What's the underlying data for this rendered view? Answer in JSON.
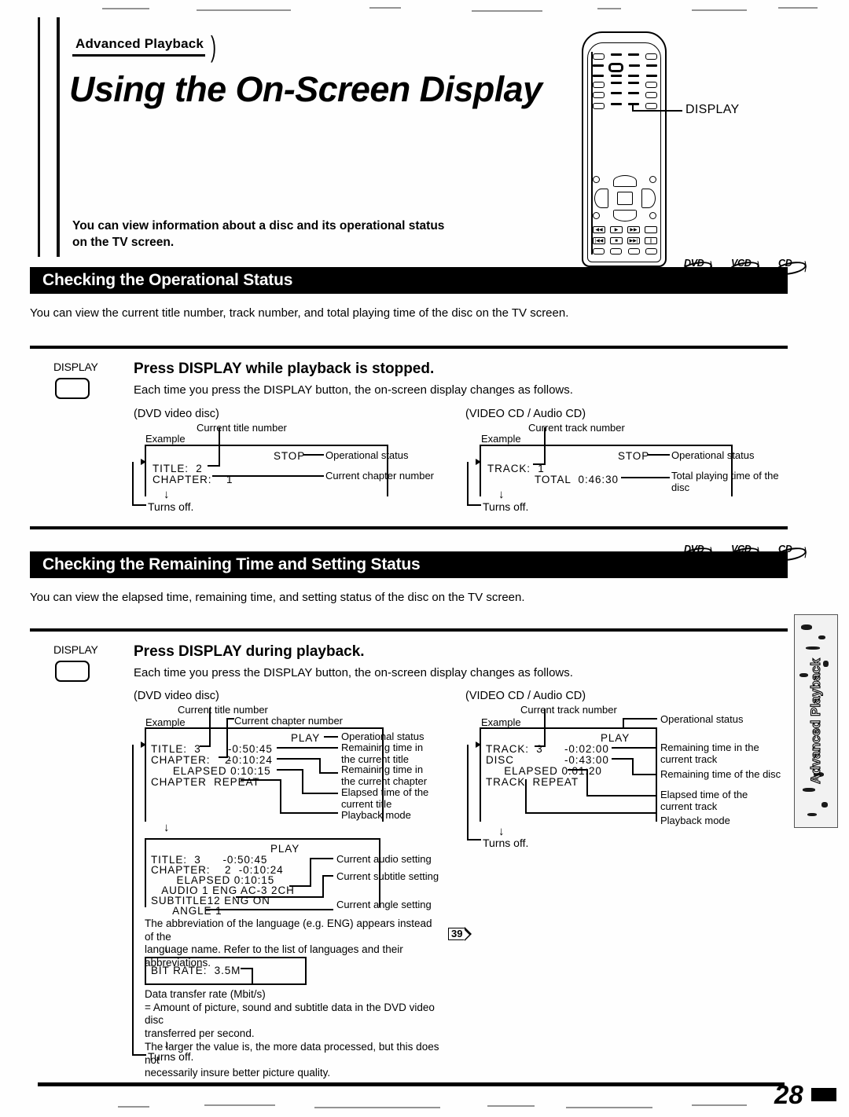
{
  "header": {
    "kicker": "Advanced Playback",
    "title": "Using the On-Screen Display",
    "lede_line1": "You can view information about a disc and its operational status",
    "lede_line2": "on the TV screen."
  },
  "remote": {
    "callout_label": "DISPLAY"
  },
  "badges": [
    {
      "label": "DVD"
    },
    {
      "label": "VCD"
    },
    {
      "label": "CD"
    }
  ],
  "sections": [
    {
      "heading": "Checking the Operational Status",
      "intro": "You can view the current title number, track number, and total playing time of the disc on the TV screen.",
      "step": {
        "button_label": "DISPLAY",
        "heading": "Press DISPLAY while playback is stopped.",
        "subtext": "Each time you press the DISPLAY button, the on-screen display changes as follows."
      },
      "dvd": {
        "title": "(DVD video disc)",
        "example_label": "Example",
        "top_caption": "Current title number",
        "osd_lines": [
          "TITLE:  2",
          "CHAPTER:    1"
        ],
        "osd_status": "STOP",
        "callouts": [
          "Operational status",
          "Current chapter number"
        ],
        "turns_off": "Turns off."
      },
      "cd": {
        "title": "(VIDEO CD / Audio CD)",
        "example_label": "Example",
        "top_caption": "Current track number",
        "osd_lines": [
          "TRACK:  1",
          "TOTAL  0:46:30"
        ],
        "osd_status": "STOP",
        "callouts": [
          "Operational status",
          "Total playing time of the disc"
        ],
        "turns_off": "Turns off."
      }
    },
    {
      "heading": "Checking the Remaining Time and Setting Status",
      "intro": "You can view the elapsed time, remaining time, and setting status of the disc on the TV screen.",
      "step": {
        "button_label": "DISPLAY",
        "heading": "Press DISPLAY during playback.",
        "subtext": "Each time you press the DISPLAY button, the on-screen display changes as follows."
      },
      "dvd": {
        "title": "(DVD video disc)",
        "example_label": "Example",
        "caption_title_number": "Current title number",
        "caption_chapter_number": "Current chapter number",
        "osd1_status": "PLAY",
        "osd1_lines": [
          "TITLE:  3",
          "CHAPTER:    2",
          "      ELAPSED 0:10:15",
          "CHAPTER  REPEAT"
        ],
        "osd1_times": [
          "-0:50:45",
          "-0:10:24"
        ],
        "callouts1": [
          "Operational status",
          "Remaining time in the current title",
          "Remaining time in the current chapter",
          "Elapsed time of the current title",
          "Playback mode"
        ],
        "osd2_status": "PLAY",
        "osd2_lines": [
          "TITLE:  3      -0:50:45",
          "CHAPTER:    2  -0:10:24",
          "       ELAPSED 0:10:15",
          "   AUDIO 1 ENG AC-3 2CH",
          "SUBTITLE12 ENG ON",
          "      ANGLE 1"
        ],
        "callouts2": [
          "Current audio setting",
          "Current subtitle setting",
          "Current angle setting"
        ],
        "lang_note_line1": "The abbreviation of the language (e.g. ENG) appears instead of the",
        "lang_note_line2": "language name. Refer to the list of languages and their abbreviations.",
        "lang_note_pageref": "39",
        "osd3_line": "BIT RATE:  3.5M",
        "bitrate_note": [
          "Data transfer rate (Mbit/s)",
          "= Amount of picture, sound and subtitle data in the DVD video disc",
          "transferred per second.",
          "The larger the value is, the more data processed, but this does not",
          "necessarily insure better picture quality."
        ],
        "turns_off": "Turns off."
      },
      "cd": {
        "title": "(VIDEO CD / Audio CD)",
        "example_label": "Example",
        "top_caption": "Current track number",
        "osd_status": "PLAY",
        "osd_lines": [
          "TRACK:  3",
          "DISC",
          "     ELAPSED 0:01:20",
          "TRACK  REPEAT"
        ],
        "osd_times": [
          "-0:02:00",
          "-0:43:00"
        ],
        "callouts": [
          "Operational status",
          "Remaining time in the current track",
          "Remaining time of the disc",
          "Elapsed time of the current track",
          "Playback mode"
        ],
        "turns_off": "Turns off."
      }
    }
  ],
  "side_tab": {
    "label": "Advanced Playback"
  },
  "footer": {
    "page_number": "28"
  }
}
